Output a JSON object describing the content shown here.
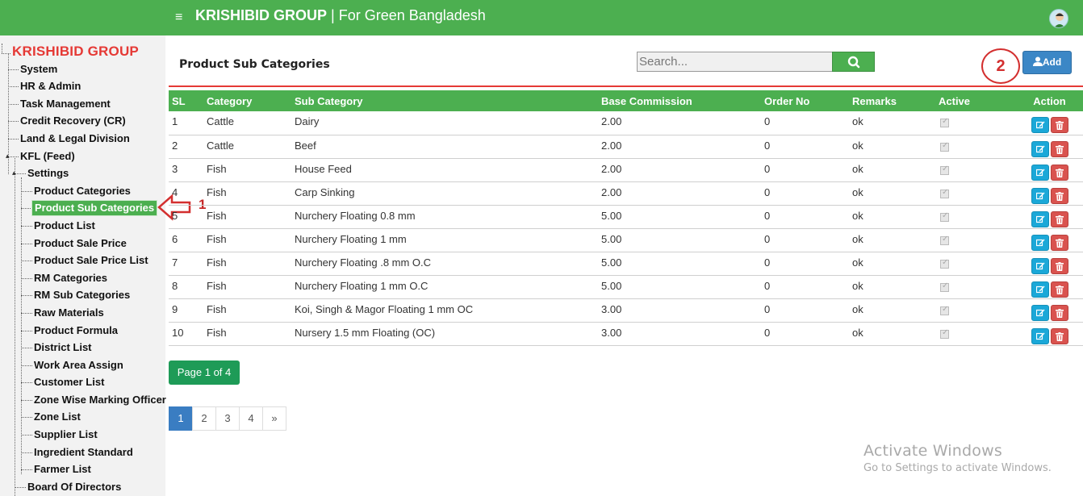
{
  "header": {
    "brand_bold": "KRISHIBID GROUP",
    "brand_rest": " | For Green Bangladesh",
    "menu_glyph": "≡"
  },
  "sidebar": {
    "root": "KRISHIBID GROUP",
    "items": [
      {
        "label": "System"
      },
      {
        "label": "HR & Admin"
      },
      {
        "label": "Task Management"
      },
      {
        "label": "Credit Recovery (CR)"
      },
      {
        "label": "Land & Legal Division"
      },
      {
        "label": "KFL (Feed)"
      },
      {
        "label": "Settings"
      },
      {
        "label": "Product Categories"
      },
      {
        "label": "Product Sub Categories"
      },
      {
        "label": "Product List"
      },
      {
        "label": "Product Sale Price"
      },
      {
        "label": "Product Sale Price List"
      },
      {
        "label": "RM Categories"
      },
      {
        "label": "RM Sub Categories"
      },
      {
        "label": "Raw Materials"
      },
      {
        "label": "Product Formula"
      },
      {
        "label": "District List"
      },
      {
        "label": "Work Area Assign"
      },
      {
        "label": "Customer List"
      },
      {
        "label": "Zone Wise Marking Officer"
      },
      {
        "label": "Zone List"
      },
      {
        "label": "Supplier List"
      },
      {
        "label": "Ingredient Standard"
      },
      {
        "label": "Farmer List"
      },
      {
        "label": "Board Of Directors"
      }
    ]
  },
  "annotations": {
    "marker_1": "1",
    "marker_2": "2"
  },
  "main": {
    "title": "Product Sub Categories",
    "search_placeholder": "Search...",
    "add_label": "Add",
    "columns": [
      "SL",
      "Category",
      "Sub Category",
      "Base Commission",
      "Order No",
      "Remarks",
      "Active",
      "Action"
    ],
    "rows": [
      {
        "sl": "1",
        "category": "Cattle",
        "sub": "Dairy",
        "commission": "2.00",
        "order": "0",
        "remarks": "ok",
        "active": true
      },
      {
        "sl": "2",
        "category": "Cattle",
        "sub": "Beef",
        "commission": "2.00",
        "order": "0",
        "remarks": "ok",
        "active": true
      },
      {
        "sl": "3",
        "category": "Fish",
        "sub": "House Feed",
        "commission": "2.00",
        "order": "0",
        "remarks": "ok",
        "active": true
      },
      {
        "sl": "4",
        "category": "Fish",
        "sub": "Carp Sinking",
        "commission": "2.00",
        "order": "0",
        "remarks": "ok",
        "active": true
      },
      {
        "sl": "5",
        "category": "Fish",
        "sub": "Nurchery Floating 0.8 mm",
        "commission": "5.00",
        "order": "0",
        "remarks": "ok",
        "active": true
      },
      {
        "sl": "6",
        "category": "Fish",
        "sub": "Nurchery Floating 1 mm",
        "commission": "5.00",
        "order": "0",
        "remarks": "ok",
        "active": true
      },
      {
        "sl": "7",
        "category": "Fish",
        "sub": "Nurchery Floating .8 mm O.C",
        "commission": "5.00",
        "order": "0",
        "remarks": "ok",
        "active": true
      },
      {
        "sl": "8",
        "category": "Fish",
        "sub": "Nurchery Floating 1 mm O.C",
        "commission": "5.00",
        "order": "0",
        "remarks": "ok",
        "active": true
      },
      {
        "sl": "9",
        "category": "Fish",
        "sub": "Koi, Singh & Magor Floating 1 mm OC",
        "commission": "3.00",
        "order": "0",
        "remarks": "ok",
        "active": true
      },
      {
        "sl": "10",
        "category": "Fish",
        "sub": "Nursery 1.5 mm Floating (OC)",
        "commission": "3.00",
        "order": "0",
        "remarks": "ok",
        "active": true
      }
    ],
    "page_info": "Page 1 of 4",
    "pages": [
      "1",
      "2",
      "3",
      "4",
      "»"
    ],
    "current_page": "1"
  },
  "watermark": {
    "line1": "Activate Windows",
    "line2": "Go to Settings to activate Windows."
  },
  "colors": {
    "accent": "#4caf50",
    "danger": "#e53935",
    "primary": "#3b87c6",
    "info": "#1ba8d8"
  }
}
